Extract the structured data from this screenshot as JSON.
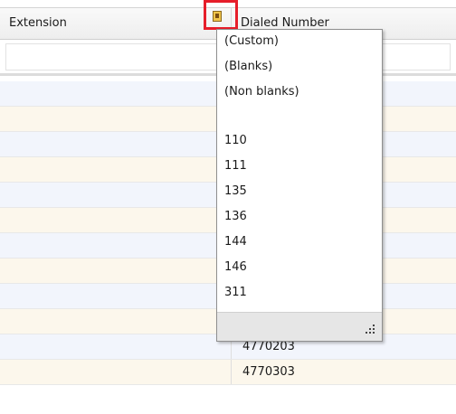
{
  "grid": {
    "columns": {
      "extension": "Extension",
      "dialed_number": "Dialed Number"
    },
    "rows": [
      {
        "extension": "",
        "dialed": ""
      },
      {
        "extension": "",
        "dialed": ""
      },
      {
        "extension": "",
        "dialed": ""
      },
      {
        "extension": "",
        "dialed": ""
      },
      {
        "extension": "",
        "dialed": ""
      },
      {
        "extension": "",
        "dialed": ""
      },
      {
        "extension": "",
        "dialed": ""
      },
      {
        "extension": "",
        "dialed": ""
      },
      {
        "extension": "",
        "dialed": ""
      },
      {
        "extension": "",
        "dialed": ""
      },
      {
        "extension": "",
        "dialed": "4770203"
      },
      {
        "extension": "",
        "dialed": "4770303"
      }
    ]
  },
  "filter_dropdown": {
    "options": [
      "(Custom)",
      "(Blanks)",
      "(Non blanks)",
      "",
      "110",
      "111",
      "135",
      "136",
      "144",
      "146",
      "311"
    ]
  },
  "colors": {
    "highlight": "#e61e2a",
    "row_odd": "#f2f5fc",
    "row_even": "#fcf7ec"
  },
  "icons": {
    "filter_button": "filter-funnel-icon",
    "resize_grip": "resize-grip-icon"
  }
}
